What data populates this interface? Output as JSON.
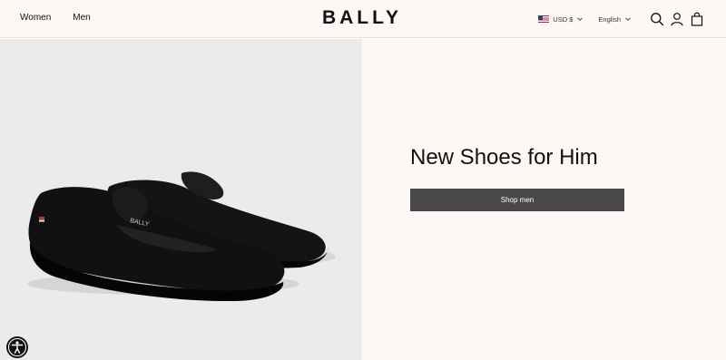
{
  "header": {
    "nav": [
      {
        "label": "Women"
      },
      {
        "label": "Men"
      }
    ],
    "logo": "BALLY",
    "currency": "USD $",
    "language": "English"
  },
  "hero": {
    "headline": "New Shoes for Him",
    "cta_label": "Shop men"
  },
  "icons": {
    "search": "search-icon",
    "account": "user-icon",
    "cart": "bag-icon",
    "accessibility": "accessibility-icon",
    "flag": "us-flag-icon"
  },
  "colors": {
    "header_bg": "#fcf8f6",
    "left_bg": "#ebebeb",
    "button_bg": "#4a4848"
  }
}
